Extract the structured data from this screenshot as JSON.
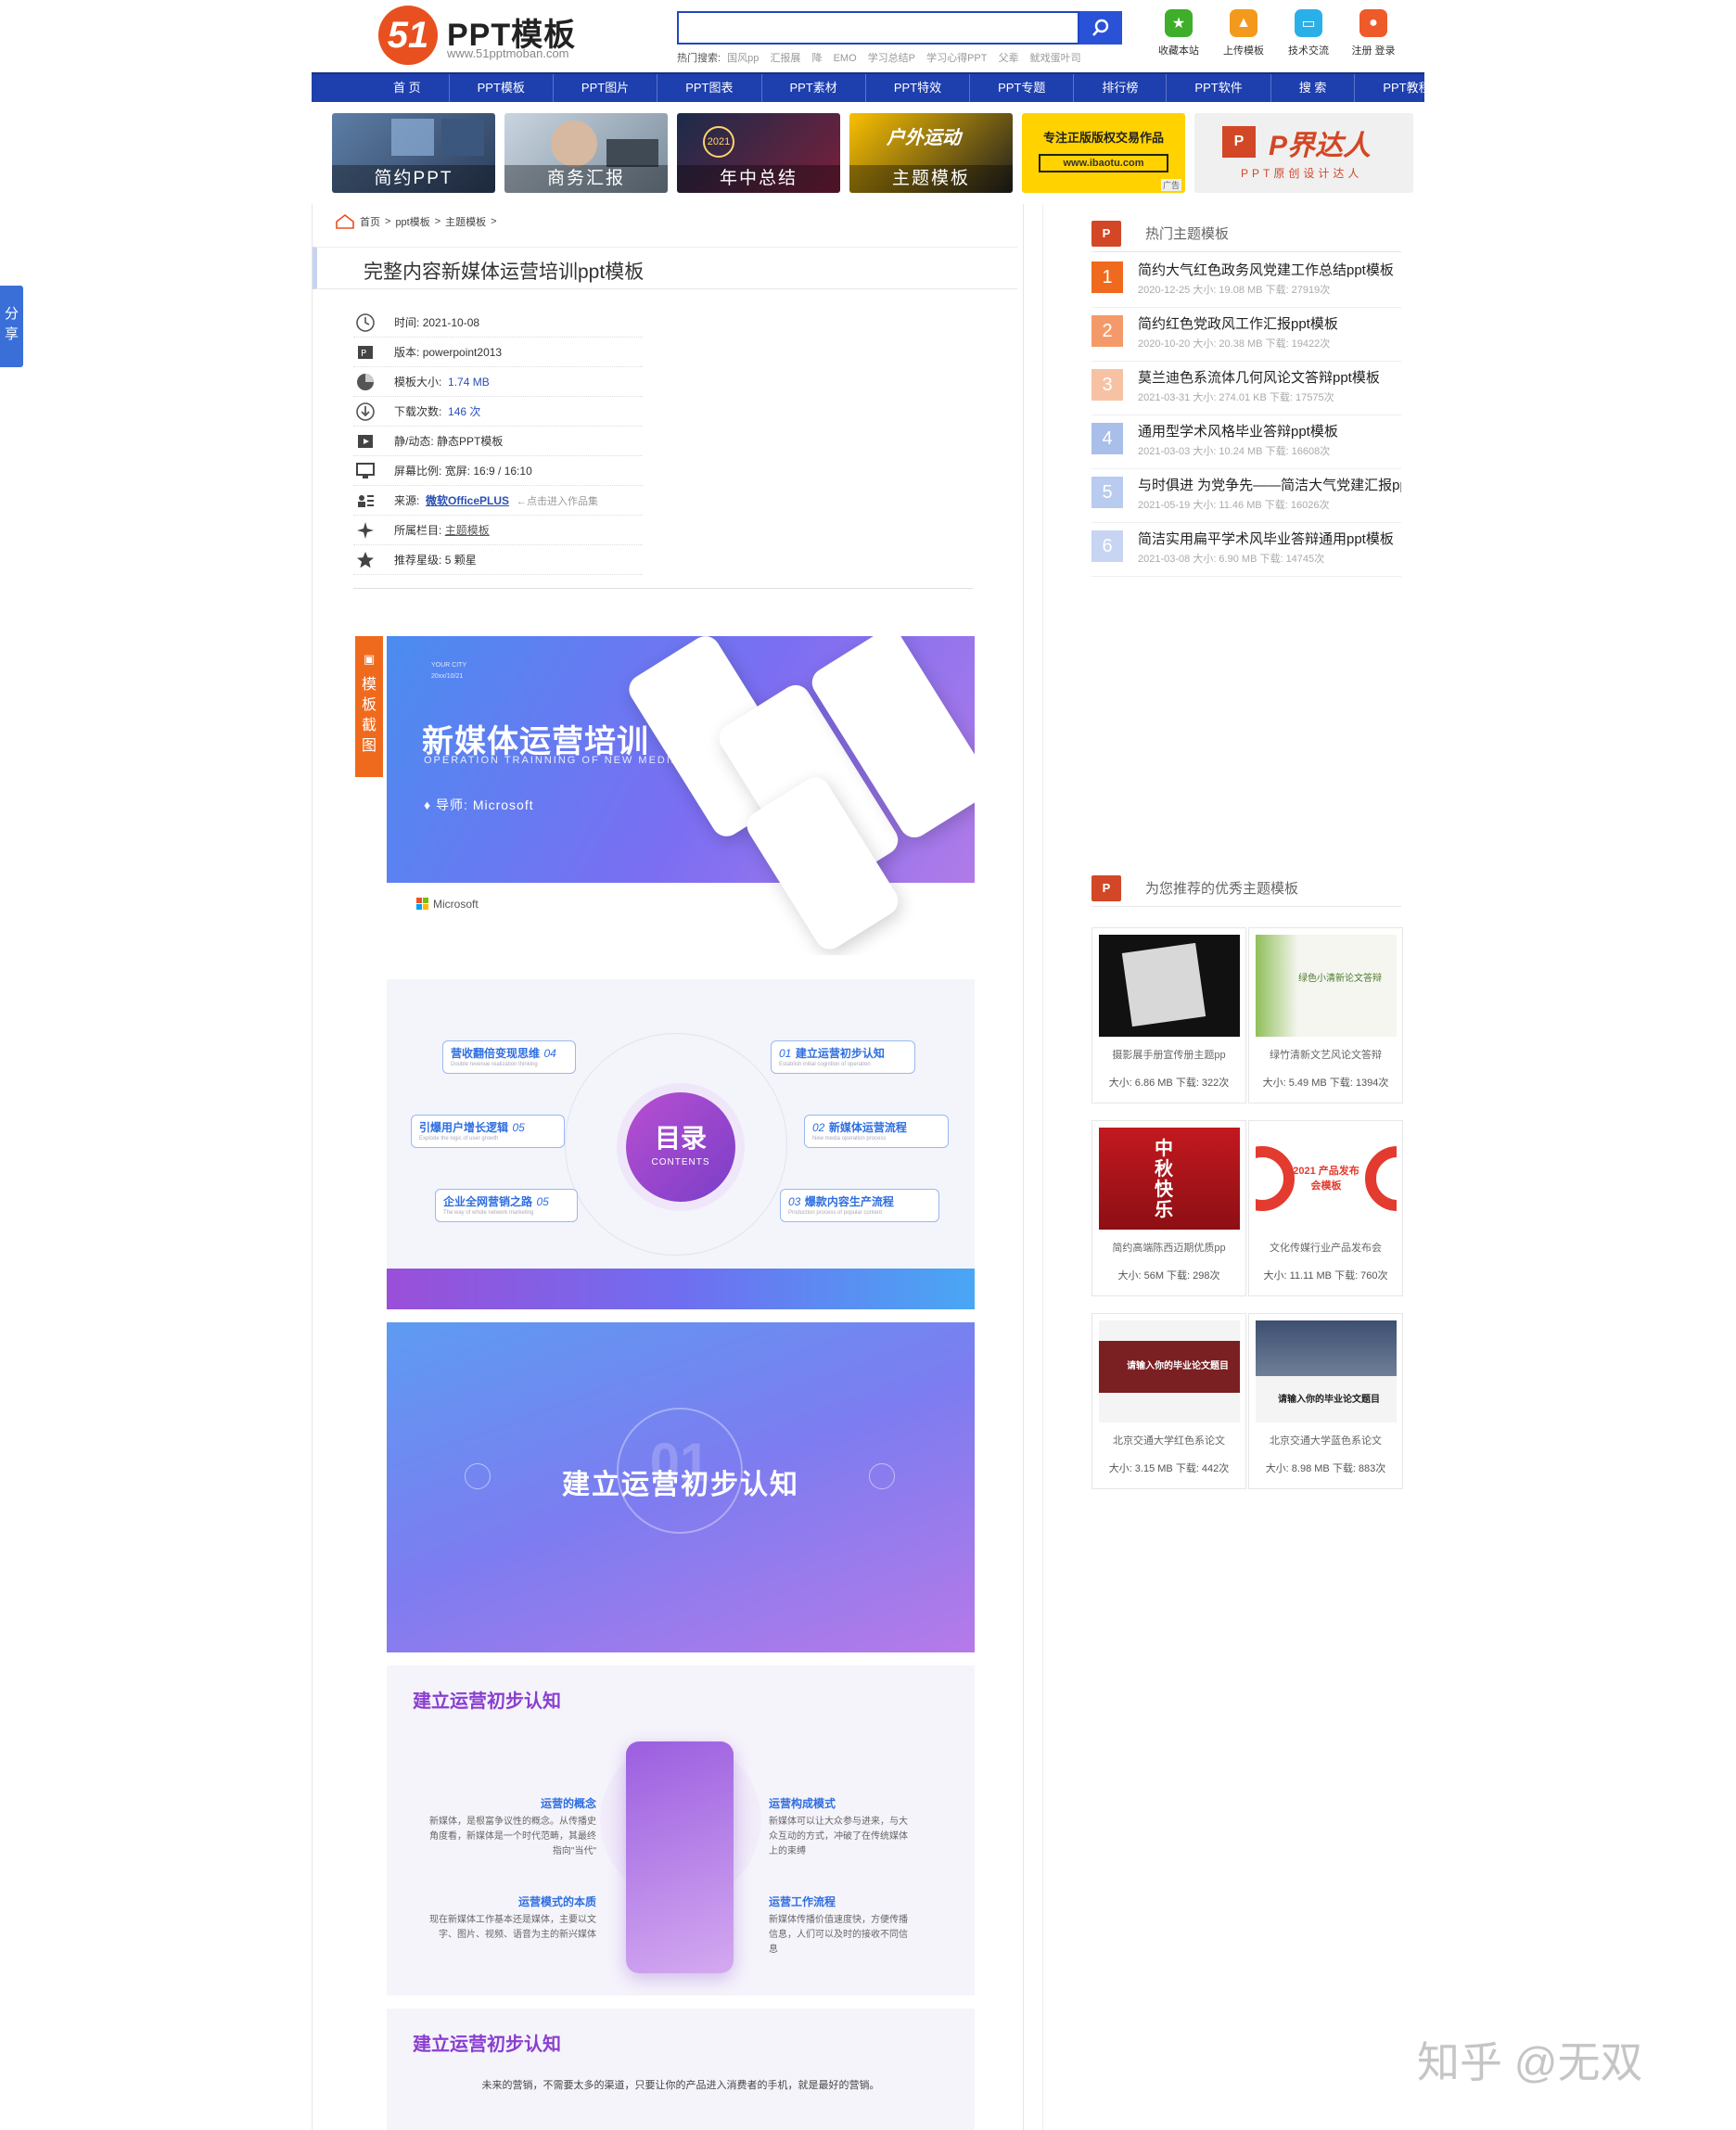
{
  "site": {
    "logo_mark": "51",
    "logo_title": "PPT模板",
    "logo_domain": "www.51pptmoban.com"
  },
  "search": {
    "placeholder": "",
    "hot_label": "热门搜索:",
    "hot_terms": [
      "国风pp",
      "汇报展",
      "降",
      "EMO",
      "学习总结P",
      "学习心得PPT",
      "父辈",
      "鱿戏蛋叶司"
    ]
  },
  "top_actions": [
    {
      "label": "收藏本站",
      "color": "#3fae2a",
      "icon": "star-icon"
    },
    {
      "label": "上传模板",
      "color": "#f39a1c",
      "icon": "upload-icon"
    },
    {
      "label": "技术交流",
      "color": "#2ab0e8",
      "icon": "chat-icon"
    },
    {
      "label": "注册 登录",
      "color": "#ef5a2a",
      "icon": "user-icon"
    }
  ],
  "nav": [
    "首 页",
    "PPT模板",
    "PPT图片",
    "PPT图表",
    "PPT素材",
    "PPT特效",
    "PPT专题",
    "排行榜",
    "PPT软件",
    "搜 索",
    "PPT教程"
  ],
  "banners": [
    {
      "label": "简约PPT"
    },
    {
      "label": "商务汇报"
    },
    {
      "label": "年中总结",
      "badge": "2021"
    },
    {
      "label": "主题模板",
      "overlay": "户外运动"
    },
    {
      "line1": "专注正版版权交易作品",
      "line2": "www.ibaotu.com",
      "ad": "广告"
    },
    {
      "title": "P界达人",
      "sub": "PPT原创设计达人"
    }
  ],
  "breadcrumb": [
    "首页",
    ">",
    "ppt模板",
    ">",
    "主题模板",
    ">"
  ],
  "page_title": "完整内容新媒体运营培训ppt模板",
  "info": {
    "time_label": "时间:",
    "time": "2021-10-08",
    "version_label": "版本:",
    "version": "powerpoint2013",
    "size_label": "模板大小:",
    "size": "1.74 MB",
    "downloads_label": "下载次数:",
    "downloads": "146 次",
    "motion_label": "静/动态:",
    "motion": "静态PPT模板",
    "ratio_label": "屏幕比例:",
    "ratio": "宽屏: 16:9 / 16:10",
    "source_label": "来源:",
    "source": "微软OfficePLUS",
    "source_hint": "←点击进入作品集",
    "column_label": "所属栏目:",
    "column": "主题模板",
    "rating_label": "推荐星级:",
    "rating": "5 颗星"
  },
  "screenshot_tag": "模板截图",
  "slides": {
    "s1": {
      "small": "YOUR CITY",
      "small2": "20xx/10/21",
      "title": "新媒体运营培训",
      "sub": "OPERATION TRAINNING OF NEW MEDIA",
      "lecturer": "导师: Microsoft",
      "brand": "Microsoft"
    },
    "s2": {
      "center": "目录",
      "center_sub": "CONTENTS",
      "items": [
        {
          "text": "营收翻倍变现思维",
          "num": "04",
          "sub": "Double revenue realization thinking"
        },
        {
          "text": "引爆用户增长逻辑",
          "num": "05",
          "sub": "Explode the logic of user growth"
        },
        {
          "text": "企业全网营销之路",
          "num": "05",
          "sub": "The way of whole network marketing"
        },
        {
          "text": "建立运营初步认知",
          "num": "01",
          "sub": "Establish initial cognition of operation"
        },
        {
          "text": "新媒体运营流程",
          "num": "02",
          "sub": "New media operation process"
        },
        {
          "text": "爆款内容生产流程",
          "num": "03",
          "sub": "Production process of popular content"
        }
      ]
    },
    "s3": {
      "num": "01",
      "title": "建立运营初步认知"
    },
    "s4": {
      "title": "建立运营初步认知",
      "blocks": [
        {
          "h": "运营的概念",
          "t": "新媒体，是根富争议性的概念。从传播史角度看，新媒体是一个时代范畴，其最终指向\"当代\""
        },
        {
          "h": "运营模式的本质",
          "t": "现在新媒体工作基本还是媒体，主要以文字、图片、视频、语音为主的新兴媒体"
        },
        {
          "h": "运营构成模式",
          "t": "新媒体可以让大众参与进来，与大众互动的方式，冲破了在传统媒体上的束缚"
        },
        {
          "h": "运营工作流程",
          "t": "新媒体传播价值速度快，方便传播信息，人们可以及时的接收不同信息"
        }
      ]
    },
    "s5": {
      "title": "建立运营初步认知",
      "desc": "未来的营销，不需要太多的渠道，只要让你的产品进入消费者的手机，就是最好的营销。"
    }
  },
  "hot_section": {
    "title": "热门主题模板"
  },
  "hot_list": [
    {
      "rank": "1",
      "title": "简约大气红色政务风党建工作总结ppt模板",
      "meta": "2020-12-25 大小: 19.08 MB 下载: 27919次",
      "color": "#f06a1e"
    },
    {
      "rank": "2",
      "title": "简约红色党政风工作汇报ppt模板",
      "meta": "2020-10-20 大小: 20.38 MB 下载: 19422次",
      "color": "#f49a6a"
    },
    {
      "rank": "3",
      "title": "莫兰迪色系流体几何风论文答辩ppt模板",
      "meta": "2021-03-31 大小: 274.01 KB 下载: 17575次",
      "color": "#f7c2a4"
    },
    {
      "rank": "4",
      "title": "通用型学术风格毕业答辩ppt模板",
      "meta": "2021-03-03 大小: 10.24 MB 下载: 16608次",
      "color": "#a9bfea"
    },
    {
      "rank": "5",
      "title": "与时俱进 为党争先——简洁大气党建汇报ppt模板",
      "meta": "2021-05-19 大小: 11.46 MB 下载: 16026次",
      "color": "#b9cbee"
    },
    {
      "rank": "6",
      "title": "简洁实用扁平学术风毕业答辩通用ppt模板",
      "meta": "2021-03-08 大小: 6.90 MB 下载: 14745次",
      "color": "#c7d5f2"
    }
  ],
  "rec_section": {
    "title": "为您推荐的优秀主题模板"
  },
  "rec_list": [
    {
      "name": "摄影展手册宣传册主题pp",
      "meta": "大小: 6.86 MB 下载: 322次",
      "thumb": "photo"
    },
    {
      "name": "绿竹清新文艺风论文答辩",
      "meta": "大小: 5.49 MB 下载: 1394次",
      "thumb": "bamboo",
      "thumb_text": "绿色小清新论文答辩"
    },
    {
      "name": "简约高端陈西迈期优质pp",
      "meta": "大小: 56M 下载: 298次",
      "thumb": "moon",
      "thumb_text": "中秋快乐"
    },
    {
      "name": "文化传媒行业产品发布会",
      "meta": "大小: 11.11 MB 下载: 760次",
      "thumb": "launch",
      "thumb_text": "2021 产品发布会模板"
    },
    {
      "name": "北京交通大学红色系论文",
      "meta": "大小: 3.15 MB 下载: 442次",
      "thumb": "red",
      "thumb_text": "请输入你的毕业论文题目"
    },
    {
      "name": "北京交通大学蓝色系论文",
      "meta": "大小: 8.98 MB 下载: 883次",
      "thumb": "blue",
      "thumb_text": "请输入你的毕业论文题目"
    }
  ],
  "share": "分享",
  "watermark": "知乎 @无双"
}
